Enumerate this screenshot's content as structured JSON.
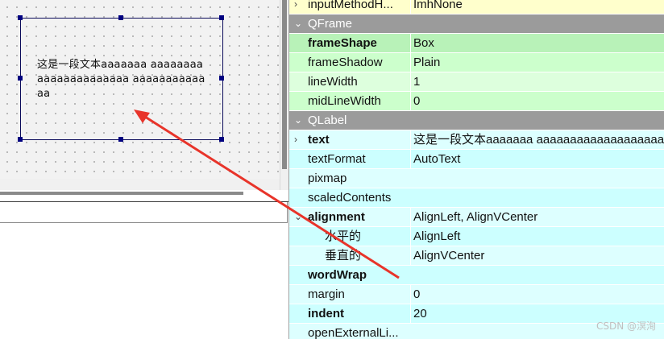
{
  "canvas": {
    "label_text": "这是一段文本aaaaaaa aaaaaaaaaaaaaaaaaaaaaa aaaaaaaaaaaaa"
  },
  "properties": {
    "rows": [
      {
        "name": "inputMethodH...",
        "value": "ImhNone",
        "arrow": "›"
      },
      {
        "group": "QFrame"
      },
      {
        "name": "frameShape",
        "value": "Box"
      },
      {
        "name": "frameShadow",
        "value": "Plain"
      },
      {
        "name": "lineWidth",
        "value": "1"
      },
      {
        "name": "midLineWidth",
        "value": "0"
      },
      {
        "group": "QLabel"
      },
      {
        "name": "text",
        "value": "这是一段文本aaaaaaa aaaaaaaaaaaaaaaaaaaaa",
        "arrow": "›"
      },
      {
        "name": "textFormat",
        "value": "AutoText"
      },
      {
        "name": "pixmap",
        "value": ""
      },
      {
        "name": "scaledContents",
        "checked": false
      },
      {
        "name": "alignment",
        "value": "AlignLeft, AlignVCenter",
        "arrow": "⌄"
      },
      {
        "name": "水平的",
        "value": "AlignLeft"
      },
      {
        "name": "垂直的",
        "value": "AlignVCenter"
      },
      {
        "name": "wordWrap",
        "checked": true
      },
      {
        "name": "margin",
        "value": "0"
      },
      {
        "name": "indent",
        "value": "20"
      },
      {
        "name": "openExternalLi...",
        "checked": false
      }
    ]
  },
  "colors": {
    "annotation_arrow": "#e8342a",
    "group_header": "#9b9b9b",
    "frame_rows": "#ddffdd",
    "label_rows": "#ddffff",
    "checkbox_checked": "#2f6fd6"
  },
  "watermark": "CSDN @溟洵"
}
